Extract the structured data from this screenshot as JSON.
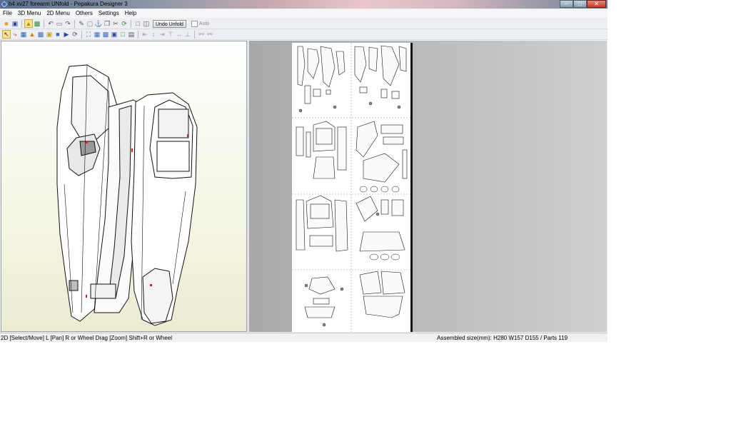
{
  "window": {
    "title": "h4 xv27 forearm UNfold - Pepakura Designer 3"
  },
  "menubar": {
    "items": [
      "File",
      "3D Menu",
      "2D Menu",
      "Others",
      "Settings",
      "Help"
    ]
  },
  "toolbar": {
    "undo_unfold_label": "Undo Unfold",
    "auto_label": "Auto",
    "auto_checked": false
  },
  "statusbar": {
    "left": "2D [Select/Move] L [Pan] R or Wheel Drag [Zoom] Shift+R or Wheel",
    "right": "Assembled size(mm): H280 W157 D155 / Parts 119"
  },
  "icons": {
    "toolbar1": [
      "open-folder-icon",
      "save-icon",
      "view-3d-icon",
      "view-2d-icon",
      "undo-icon",
      "trash-icon",
      "redo-icon",
      "pencil-icon",
      "cube-icon",
      "anchor-icon",
      "copy-icon",
      "scissors-icon",
      "refresh-icon",
      "single-pane-icon",
      "split-pane-icon"
    ],
    "toolbar2": [
      "select-icon",
      "edge-icon",
      "texture-icon",
      "color-icon",
      "fill-icon",
      "box-icon",
      "rotate-icon",
      "hand-icon",
      "redo-arrow-icon",
      "layout-icon",
      "arrange-icon",
      "group-icon",
      "print-icon",
      "page-icon",
      "align-left-icon",
      "align-center-icon",
      "align-right-icon",
      "align-top-icon",
      "align-middle-icon",
      "align-bottom-icon",
      "zoom-in-icon",
      "zoom-out-icon"
    ]
  }
}
